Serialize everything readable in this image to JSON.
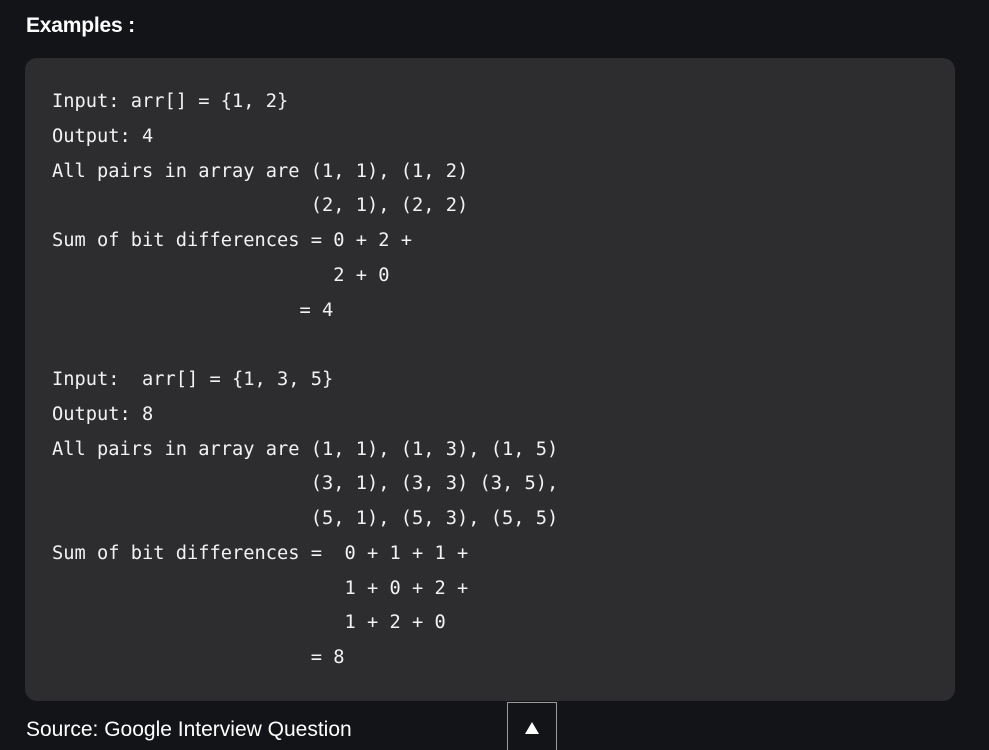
{
  "heading": "Examples :",
  "code_lines": [
    "Input: arr[] = {1, 2}",
    "Output: 4",
    "All pairs in array are (1, 1), (1, 2)",
    "                       (2, 1), (2, 2)",
    "Sum of bit differences = 0 + 2 +",
    "                         2 + 0",
    "                      = 4",
    "",
    "Input:  arr[] = {1, 3, 5}",
    "Output: 8",
    "All pairs in array are (1, 1), (1, 3), (1, 5)",
    "                       (3, 1), (3, 3) (3, 5),",
    "                       (5, 1), (5, 3), (5, 5)",
    "Sum of bit differences =  0 + 1 + 1 +",
    "                          1 + 0 + 2 +",
    "                          1 + 2 + 0",
    "                       = 8"
  ],
  "source": "Source: Google Interview Question",
  "scroll_top_icon": "arrow-up-icon"
}
